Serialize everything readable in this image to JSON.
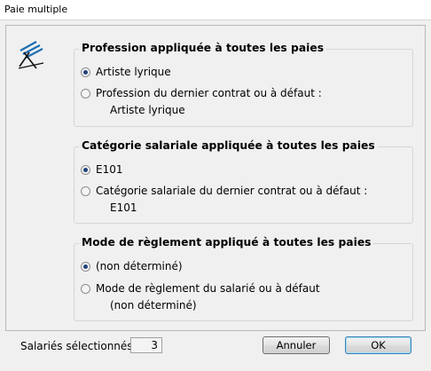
{
  "window": {
    "title": "Paie multiple"
  },
  "groups": [
    {
      "legend": "Profession appliquée à toutes les paies",
      "option1": "Artiste lyrique",
      "option2": "Profession du dernier contrat ou à défaut :",
      "option2_value": "Artiste lyrique",
      "selected": 1
    },
    {
      "legend": "Catégorie salariale appliquée à toutes les paies",
      "option1": "E101",
      "option2": "Catégorie salariale du dernier contrat ou à défaut :",
      "option2_value": "E101",
      "selected": 1
    },
    {
      "legend": "Mode de règlement appliqué à toutes les paies",
      "option1": "(non déterminé)",
      "option2": "Mode de règlement du salarié ou à défaut",
      "option2_value": "(non déterminé)",
      "selected": 1
    }
  ],
  "footer": {
    "selected_label": "Salariés sélectionnés",
    "selected_count": "3",
    "cancel_label": "Annuler",
    "ok_label": "OK"
  },
  "colors": {
    "radio_dot": "#22427a",
    "logo_blue": "#1f6fb4"
  },
  "icons": {
    "logo": "app-logo-icon"
  }
}
